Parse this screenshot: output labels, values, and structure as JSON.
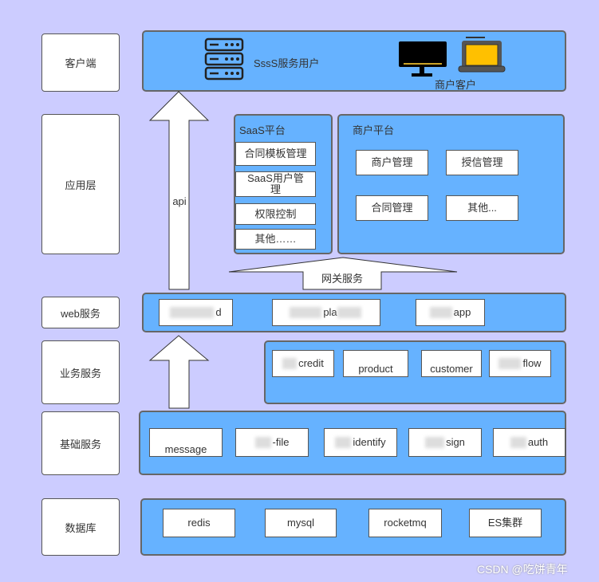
{
  "layers": {
    "client": "客户端",
    "app": "应用层",
    "web": "web服务",
    "business": "业务服务",
    "base": "基础服务",
    "db": "数据库"
  },
  "client": {
    "saas_users": "SssS服务用户",
    "merchant_clients": "商户客户"
  },
  "arrows": {
    "api": "api",
    "gateway": "网关服务"
  },
  "saas_platform": {
    "title": "SaaS平台",
    "items": [
      "合同模板管理",
      "SaaS用户管理",
      "权限控制",
      "其他……"
    ]
  },
  "merchant_platform": {
    "title": "商户平台",
    "items": [
      "商户管理",
      "授信管理",
      "合同管理",
      "其他..."
    ]
  },
  "web_services": [
    "d",
    "pla",
    "app"
  ],
  "business_services": [
    "credit",
    "product",
    "customer",
    "flow"
  ],
  "base_services": [
    "message",
    "-file",
    "identify",
    "sign",
    "auth"
  ],
  "databases": [
    "redis",
    "mysql",
    "rocketmq",
    "ES集群"
  ],
  "watermark": "CSDN @吃饼青年",
  "colors": {
    "background": "#CCCCFF",
    "band": "#66B2FF"
  }
}
